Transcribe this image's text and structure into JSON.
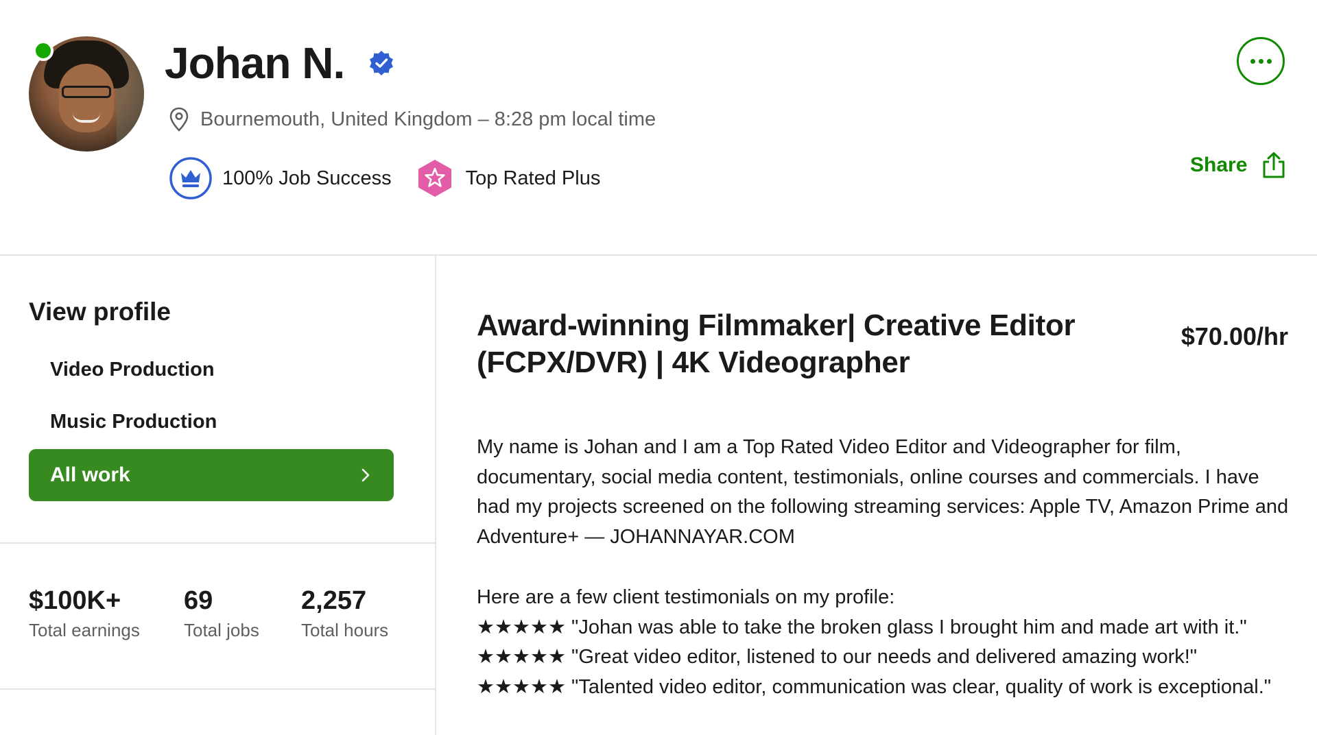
{
  "profile": {
    "name": "Johan N.",
    "location": "Bournemouth, United Kingdom – 8:28 pm local time",
    "job_success": "100% Job Success",
    "top_rated": "Top Rated Plus",
    "share_label": "Share",
    "online": true
  },
  "sidebar": {
    "title": "View profile",
    "items": [
      {
        "label": "Video Production",
        "active": false
      },
      {
        "label": "Music Production",
        "active": false
      },
      {
        "label": "All work",
        "active": true
      }
    ]
  },
  "stats": [
    {
      "value": "$100K+",
      "label": "Total earnings"
    },
    {
      "value": "69",
      "label": "Total jobs"
    },
    {
      "value": "2,257",
      "label": "Total hours"
    }
  ],
  "main": {
    "title": "Award-winning Filmmaker| Creative Editor (FCPX/DVR) | 4K Videographer",
    "rate": "$70.00/hr",
    "intro": "My name is Johan and I am a Top Rated Video Editor and Videographer for film, documentary, social media content, testimonials, online courses and commercials. I have had my projects screened on the following streaming services: Apple TV, Amazon Prime and Adventure+ — JOHANNAYAR.COM",
    "testimonials_heading": "Here are a few client testimonials on my profile:",
    "testimonials": [
      "★★★★★ \"Johan was able to take the broken glass I brought him and made art with it.\"",
      "★★★★★ \"Great video editor, listened to our needs and delivered amazing work!\"",
      "★★★★★ \"Talented video editor, communication was clear, quality of work is exceptional.\""
    ]
  },
  "colors": {
    "accent_green": "#368a1f",
    "verified_blue": "#2f5fd1",
    "top_rated_pink": "#e35ca8",
    "online_green": "#14a800"
  },
  "icons": [
    "verified-badge-icon",
    "location-pin-icon",
    "crown-icon",
    "star-badge-icon",
    "more-dots-icon",
    "share-icon",
    "chevron-right-icon"
  ]
}
